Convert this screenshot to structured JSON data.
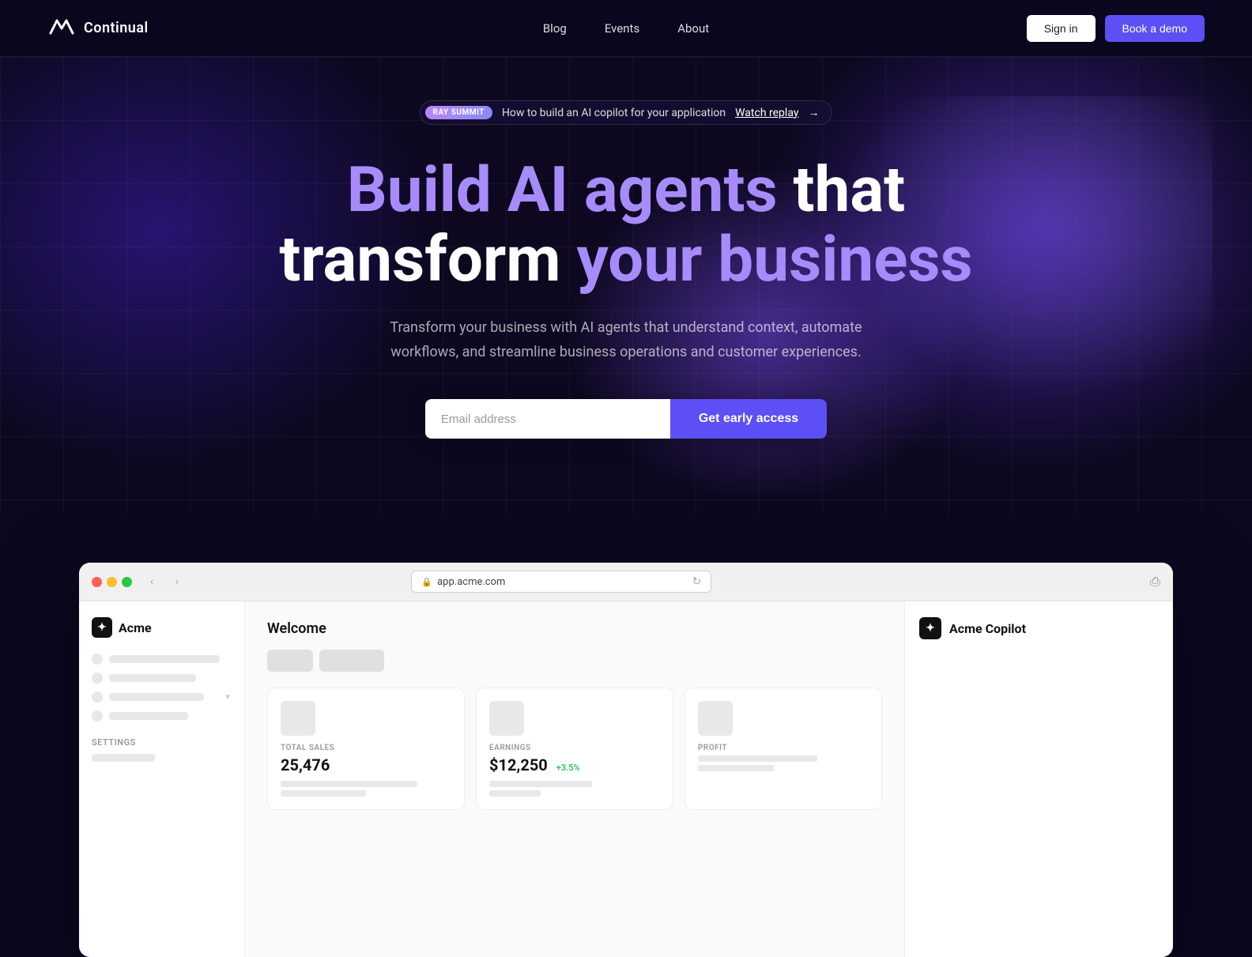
{
  "brand": {
    "name": "Continual",
    "logo_alt": "Continual logo"
  },
  "nav": {
    "links": [
      {
        "id": "blog",
        "label": "Blog"
      },
      {
        "id": "events",
        "label": "Events"
      },
      {
        "id": "about",
        "label": "About"
      }
    ],
    "signin_label": "Sign in",
    "demo_label": "Book a demo"
  },
  "hero": {
    "banner": {
      "tag": "RAY SUMMIT",
      "text": "How to build an AI copilot for your application",
      "link": "Watch replay",
      "arrow": "→"
    },
    "headline_line1": "Build AI agents that",
    "headline_line2_white": "transform",
    "headline_line2_purple": "your business",
    "subtext": "Transform your business with AI agents that understand context, automate workflows, and streamline business operations and customer experiences.",
    "email_placeholder": "Email address",
    "cta_label": "Get early access"
  },
  "browser": {
    "url": "app.acme.com",
    "nav_back": "‹",
    "nav_forward": "›",
    "app": {
      "sidebar": {
        "logo_name": "Acme",
        "skeleton_rows": [
          {
            "w1": 30,
            "w2": 140
          },
          {
            "w1": 30,
            "w2": 110
          },
          {
            "w1": 30,
            "w2": 120,
            "has_chevron": true
          },
          {
            "w1": 30,
            "w2": 100
          }
        ],
        "settings_label": "SETTINGS",
        "settings_row_w": 80
      },
      "main": {
        "welcome_label": "Welcome",
        "pill1_w": 58,
        "pill2_w": 82,
        "stats": [
          {
            "label": "TOTAL SALES",
            "value": "25,476",
            "badge": "",
            "bar1_w": "80%",
            "bar2_w": "50%"
          },
          {
            "label": "EARNINGS",
            "value": "$12,250",
            "badge": "+3.5%",
            "bar1_w": "60%",
            "bar2_w": "30%"
          },
          {
            "label": "PROFIT",
            "value": "",
            "badge": "",
            "bar1_w": "70%",
            "bar2_w": "45%"
          }
        ]
      },
      "copilot": {
        "icon_alt": "Acme Copilot icon",
        "label": "Acme Copilot"
      }
    }
  }
}
